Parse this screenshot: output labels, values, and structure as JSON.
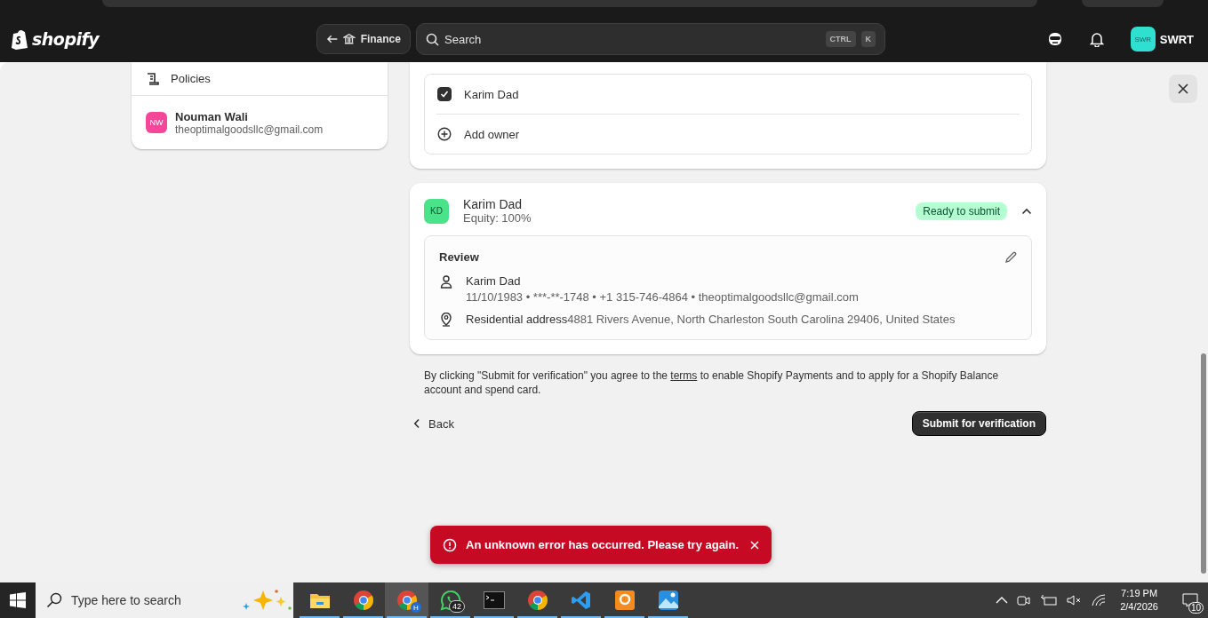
{
  "topbar": {
    "logo": "shopify",
    "back_label": "Finance",
    "search": {
      "placeholder": "Search",
      "keys": [
        "CTRL",
        "K"
      ]
    },
    "store": {
      "initials": "SWR",
      "name": "SWRT"
    }
  },
  "sidebar": {
    "items": [
      {
        "kind": "link",
        "label": "Policies"
      },
      {
        "kind": "account",
        "initials": "NW",
        "name": "Nouman Wali",
        "email": "theoptimalgoodsllc@gmail.com"
      }
    ]
  },
  "owners": [
    {
      "name": "Karim Dad",
      "checked": true
    }
  ],
  "add_owner": "Add owner",
  "owner_card": {
    "initials": "KD",
    "name": "Karim Dad",
    "equity": "Equity: 100%",
    "status": "Ready to submit",
    "expanded": true,
    "review": {
      "title": "Review",
      "name": "Karim Dad",
      "details": "11/10/1983 • ***-**-1748 • +1 315-746-4864 • theoptimalgoodsllc@gmail.com",
      "address_label": "Residential address",
      "address": "4881 Rivers Avenue, North Charleston South Carolina 29406, United States"
    }
  },
  "consent": {
    "before": "By clicking \"Submit for verification\" you agree to the ",
    "link": "terms",
    "after": " to enable Shopify Payments and to apply for a Shopify Balance account and spend card."
  },
  "back": "Back",
  "submit": "Submit for verification",
  "toast": {
    "message": "An unknown error has occurred. Please try again."
  },
  "taskbar": {
    "search_placeholder": "Type here to search",
    "apps": [
      {
        "kind": "folder",
        "selected": false
      },
      {
        "kind": "chrome",
        "selected": false
      },
      {
        "kind": "chrome",
        "selected": true,
        "badge": "H"
      },
      {
        "kind": "whatsapp",
        "selected": false,
        "badge": "42"
      },
      {
        "kind": "terminal",
        "selected": false
      },
      {
        "kind": "chrome",
        "selected": false
      },
      {
        "kind": "vscode",
        "selected": false
      },
      {
        "kind": "orange",
        "selected": false
      },
      {
        "kind": "photos",
        "selected": false
      }
    ],
    "time": "7:19 PM",
    "date": "2/4/2026",
    "notifications": "10"
  }
}
